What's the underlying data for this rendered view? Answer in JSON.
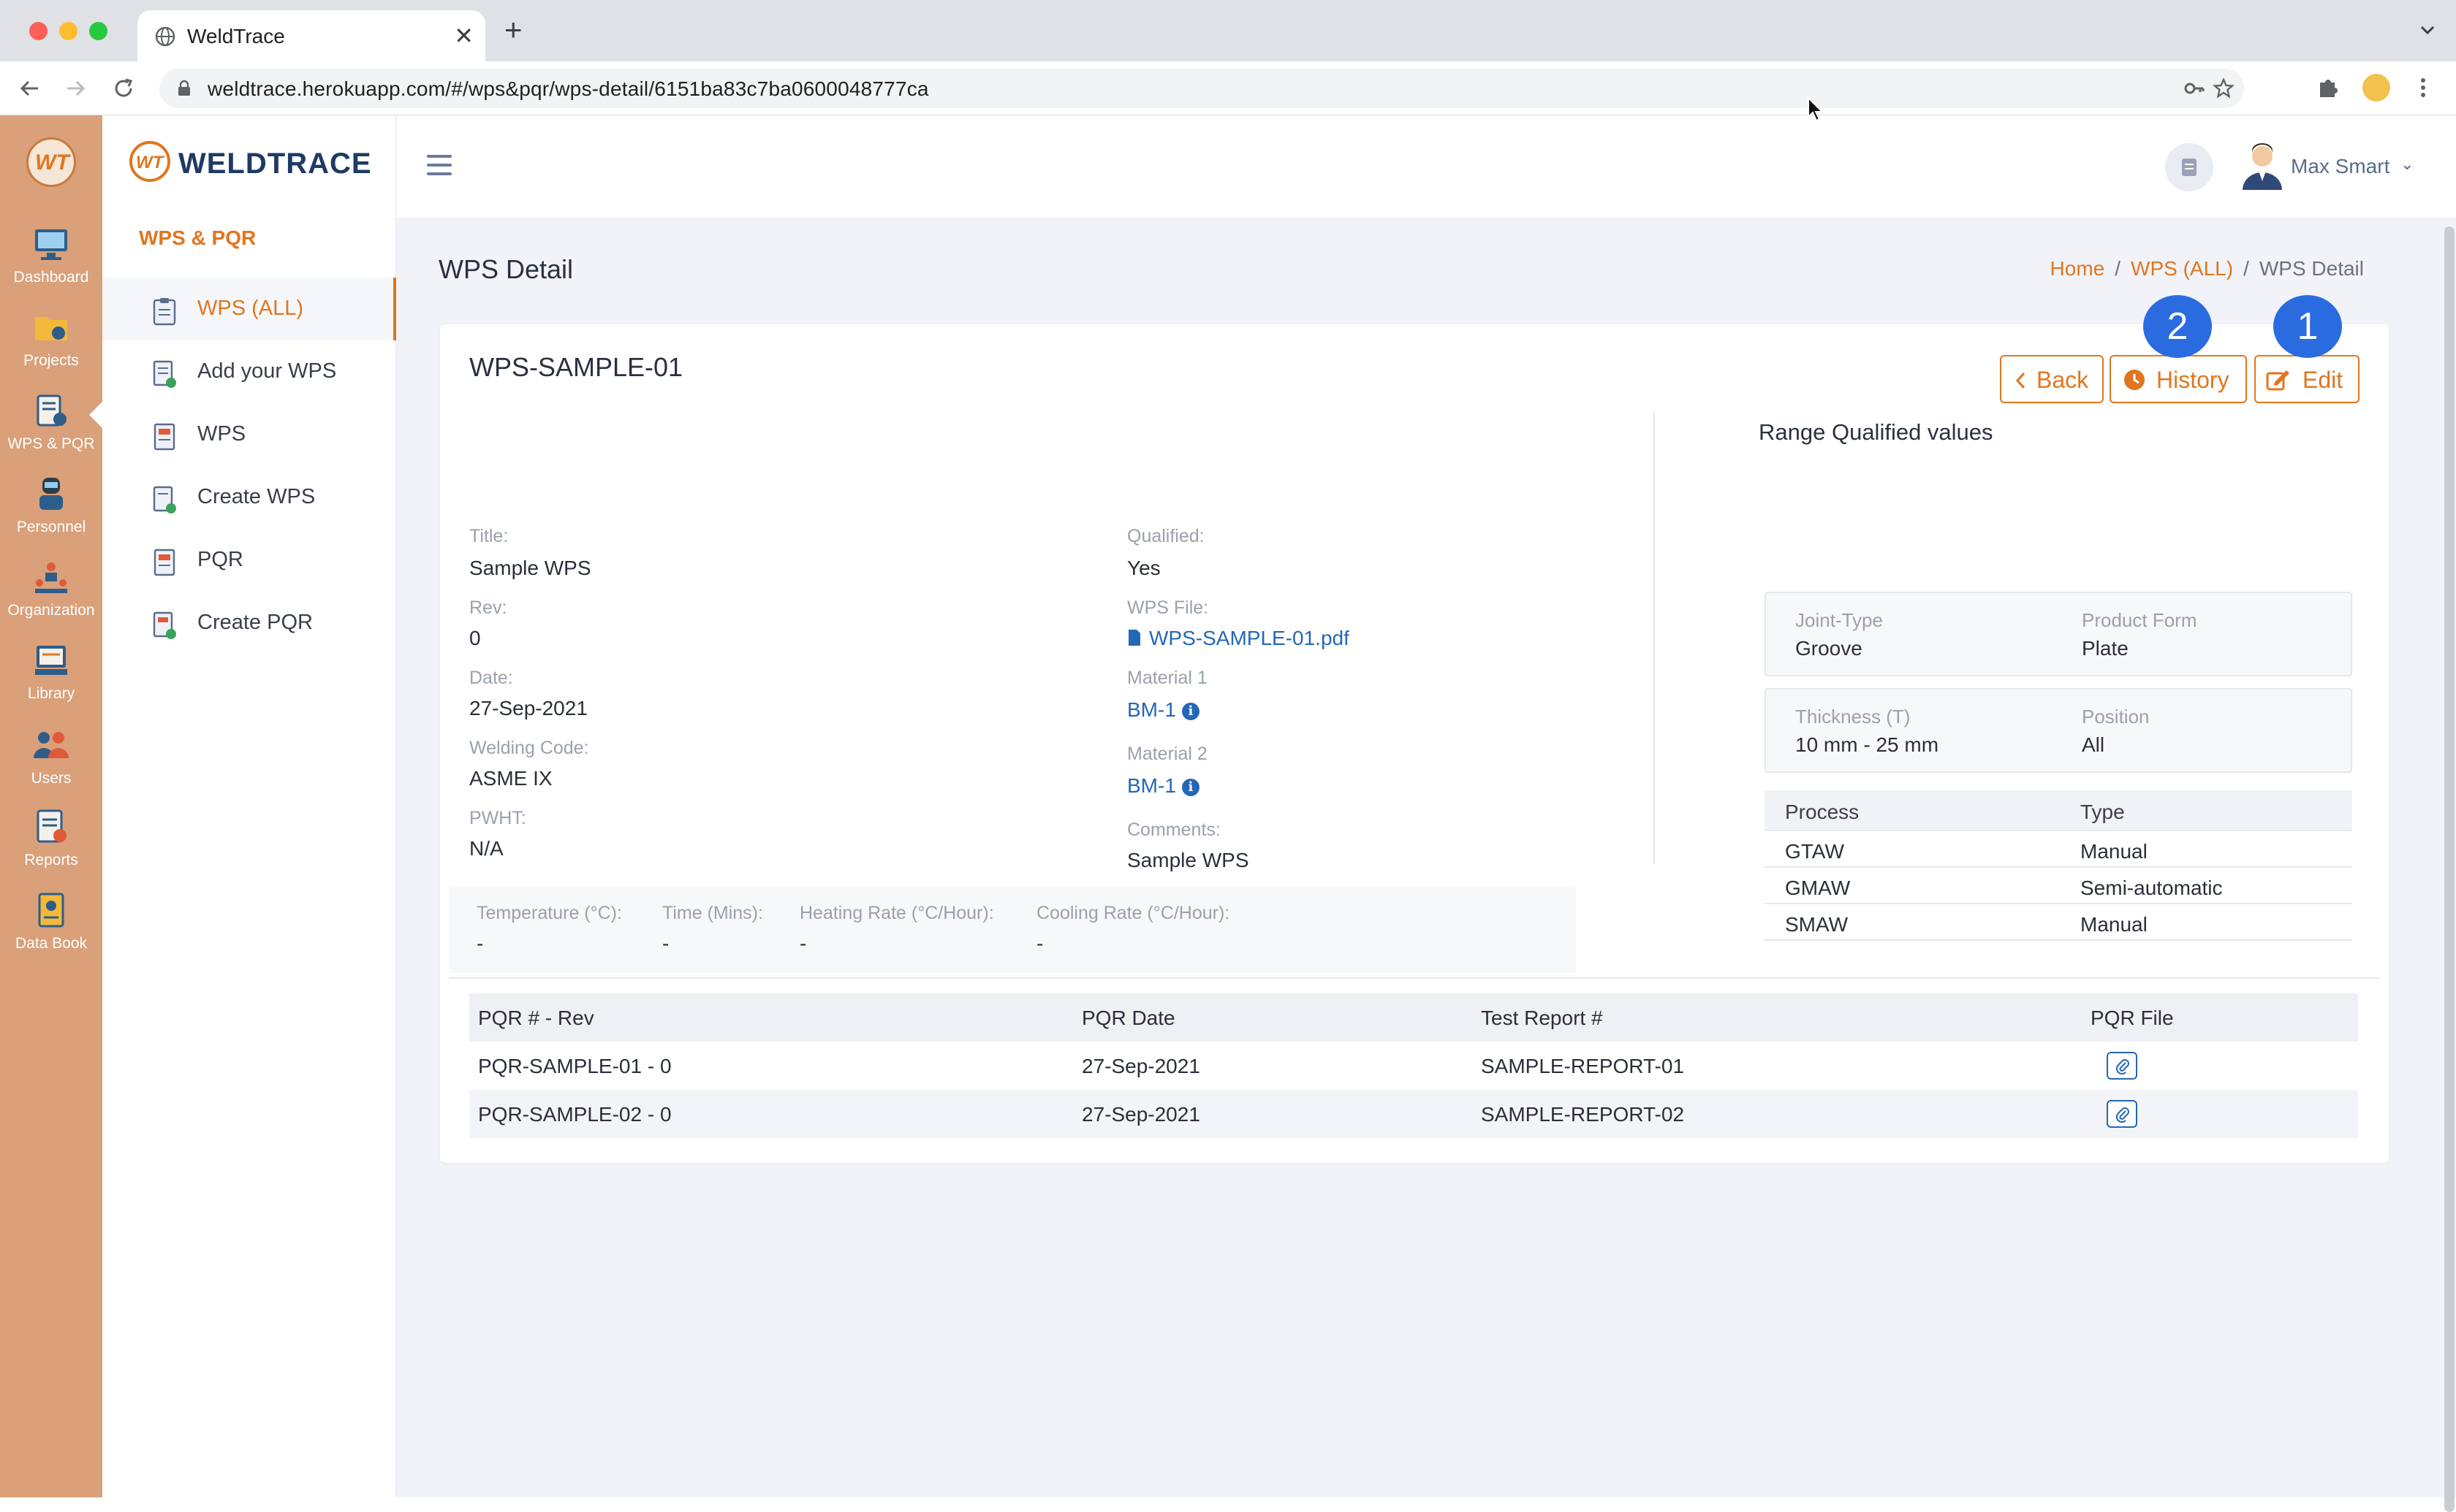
{
  "browser": {
    "tab_title": "WeldTrace",
    "url": "weldtrace.herokuapp.com/#/wps&pqr/wps-detail/6151ba83c7ba0600048777ca"
  },
  "rail": {
    "logo_text": "WT",
    "items": [
      {
        "label": "Dashboard",
        "icon": "dashboard-icon"
      },
      {
        "label": "Projects",
        "icon": "projects-icon"
      },
      {
        "label": "WPS & PQR",
        "icon": "wps-pqr-icon"
      },
      {
        "label": "Personnel",
        "icon": "personnel-icon"
      },
      {
        "label": "Organization",
        "icon": "organization-icon"
      },
      {
        "label": "Library",
        "icon": "library-icon"
      },
      {
        "label": "Users",
        "icon": "users-icon"
      },
      {
        "label": "Reports",
        "icon": "reports-icon"
      },
      {
        "label": "Data Book",
        "icon": "data-book-icon"
      }
    ]
  },
  "sidebar": {
    "brand": "WELDTRACE",
    "section_title": "WPS & PQR",
    "items": [
      {
        "label": "WPS (ALL)",
        "active": true
      },
      {
        "label": "Add your WPS"
      },
      {
        "label": "WPS"
      },
      {
        "label": "Create WPS"
      },
      {
        "label": "PQR"
      },
      {
        "label": "Create PQR"
      }
    ]
  },
  "topbar": {
    "user_name": "Max Smart"
  },
  "page": {
    "title": "WPS Detail",
    "breadcrumb": [
      "Home",
      "WPS (ALL)",
      "WPS Detail"
    ]
  },
  "wps": {
    "name": "WPS-SAMPLE-01",
    "buttons": {
      "back": "Back",
      "history": "History",
      "edit": "Edit"
    },
    "badges": {
      "history": "2",
      "edit": "1"
    },
    "left_fields": [
      {
        "label": "Title:",
        "value": "Sample WPS"
      },
      {
        "label": "Rev:",
        "value": "0"
      },
      {
        "label": "Date:",
        "value": "27-Sep-2021"
      },
      {
        "label": "Welding Code:",
        "value": "ASME IX"
      },
      {
        "label": "PWHT:",
        "value": "N/A"
      }
    ],
    "right_fields": {
      "qualified_label": "Qualified:",
      "qualified_value": "Yes",
      "wps_file_label": "WPS File:",
      "wps_file_value": "WPS-SAMPLE-01.pdf",
      "material1_label": "Material 1",
      "material1_value": "BM-1",
      "material2_label": "Material 2",
      "material2_value": "BM-1",
      "comments_label": "Comments:",
      "comments_value": "Sample WPS"
    },
    "pwht": [
      {
        "label": "Temperature (°C):",
        "value": "-"
      },
      {
        "label": "Time (Mins):",
        "value": "-"
      },
      {
        "label": "Heating Rate (°C/Hour):",
        "value": "-"
      },
      {
        "label": "Cooling Rate (°C/Hour):",
        "value": "-"
      }
    ],
    "range": {
      "title": "Range Qualified values",
      "joint_type_label": "Joint-Type",
      "joint_type_value": "Groove",
      "product_form_label": "Product Form",
      "product_form_value": "Plate",
      "thickness_label": "Thickness (T)",
      "thickness_value": "10 mm - 25 mm",
      "position_label": "Position",
      "position_value": "All",
      "process_headers": [
        "Process",
        "Type"
      ],
      "processes": [
        {
          "process": "GTAW",
          "type": "Manual"
        },
        {
          "process": "GMAW",
          "type": "Semi-automatic"
        },
        {
          "process": "SMAW",
          "type": "Manual"
        }
      ]
    },
    "pqr_table": {
      "headers": [
        "PQR # - Rev",
        "PQR Date",
        "Test Report #",
        "PQR File"
      ],
      "rows": [
        {
          "pqr": "PQR-SAMPLE-01 - 0",
          "date": "27-Sep-2021",
          "report": "SAMPLE-REPORT-01"
        },
        {
          "pqr": "PQR-SAMPLE-02 - 0",
          "date": "27-Sep-2021",
          "report": "SAMPLE-REPORT-02"
        }
      ]
    }
  },
  "colors": {
    "accent": "#e0761f",
    "rail": "#d9a07a",
    "link": "#2467b8",
    "badge": "#2b6be0"
  }
}
